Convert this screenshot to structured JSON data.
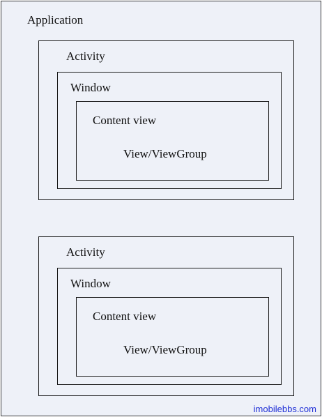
{
  "application": {
    "label": "Application"
  },
  "activities": [
    {
      "label": "Activity",
      "window": {
        "label": "Window",
        "content": {
          "label": "Content view",
          "view": "View/ViewGroup"
        }
      }
    },
    {
      "label": "Activity",
      "window": {
        "label": "Window",
        "content": {
          "label": "Content view",
          "view": "View/ViewGroup"
        }
      }
    }
  ],
  "watermark": "imobilebbs.com",
  "colors": {
    "background": "#eef1f8",
    "border": "#1a1a1a",
    "watermark": "#1f2fd6"
  }
}
